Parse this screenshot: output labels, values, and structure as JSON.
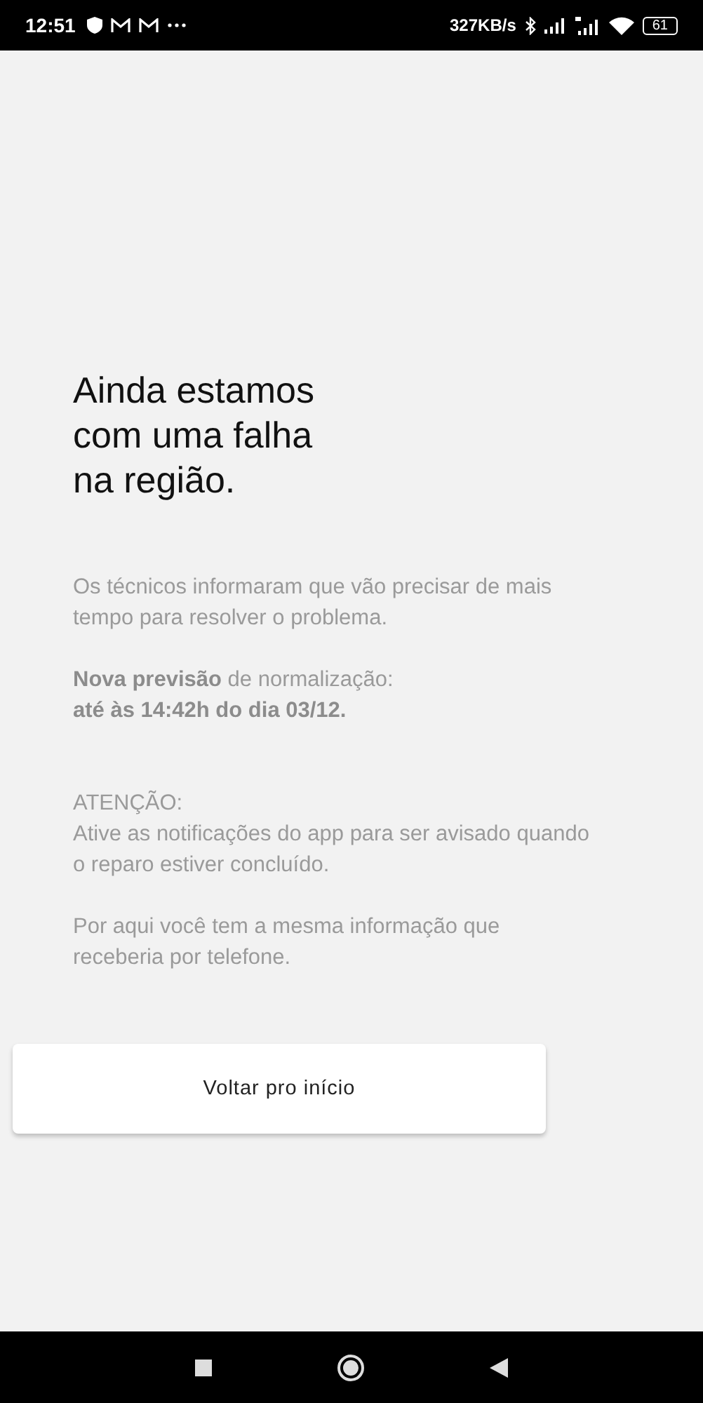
{
  "status_bar": {
    "time": "12:51",
    "speed": "327KB/s",
    "battery": "61"
  },
  "heading": [
    "Ainda estamos",
    "com uma falha",
    "na região."
  ],
  "paragraphs": [
    {
      "kind": "plain",
      "lines": [
        "Os técnicos informaram que vão precisar de mais",
        "tempo para resolver o problema."
      ]
    },
    {
      "kind": "plain",
      "lines": [
        "**Nova previsão** de normalização:",
        "**até às 14:42h do dia 03/12.**"
      ]
    },
    {
      "kind": "notice",
      "lines": [
        "ATENÇÃO:",
        "Ative as notificações do app para ser avisado quando",
        "o reparo estiver concluído."
      ]
    },
    {
      "kind": "plain",
      "lines": [
        "Por aqui você tem a mesma informação que",
        "receberia por telefone."
      ]
    }
  ],
  "button": "Voltar pro início"
}
